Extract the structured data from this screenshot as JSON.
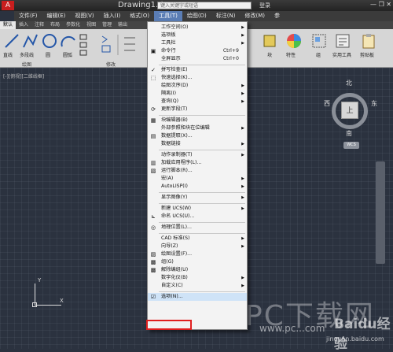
{
  "titlebar": {
    "app_button": "A",
    "doc_title": "Drawing1.d...",
    "search_placeholder": "键入关键字或短语",
    "signin": "登录",
    "window_controls": "— ❐ ✕"
  },
  "menubar": [
    {
      "label": "文件(F)"
    },
    {
      "label": "编辑(E)"
    },
    {
      "label": "视图(V)"
    },
    {
      "label": "插入(I)"
    },
    {
      "label": "格式(O)"
    },
    {
      "label": "工具(T)",
      "active": true
    },
    {
      "label": "绘图(D)"
    },
    {
      "label": "标注(N)"
    },
    {
      "label": "修改(M)"
    },
    {
      "label": "参"
    }
  ],
  "tabs": [
    {
      "label": "默认",
      "active": true
    },
    {
      "label": "插入"
    },
    {
      "label": "注释"
    },
    {
      "label": "布局"
    },
    {
      "label": "参数化"
    },
    {
      "label": "视图"
    },
    {
      "label": "管理"
    },
    {
      "label": "输出"
    }
  ],
  "ribbon": {
    "tools": [
      {
        "label": "直线",
        "icon": "line-icon"
      },
      {
        "label": "多段线",
        "icon": "polyline-icon"
      },
      {
        "label": "圆",
        "icon": "circle-icon"
      },
      {
        "label": "圆弧",
        "icon": "arc-icon"
      }
    ],
    "panel_draw": "绘图",
    "panel_modify": "修改",
    "right_tools": [
      {
        "label": "块",
        "icon": "block-icon"
      },
      {
        "label": "特性",
        "icon": "properties-icon"
      },
      {
        "label": "组",
        "icon": "group-icon"
      },
      {
        "label": "实用工具",
        "icon": "utilities-icon"
      },
      {
        "label": "剪贴板",
        "icon": "clipboard-icon"
      }
    ]
  },
  "viewport_label": "[-][俯视][二维线框]",
  "viewcube": {
    "north": "北",
    "south": "南",
    "east": "东",
    "west": "西",
    "face": "上",
    "wcs": "WCS"
  },
  "ucs": {
    "x": "X",
    "y": "Y"
  },
  "tools_menu": {
    "items": [
      {
        "label": "工作空间(O)",
        "arrow": true,
        "icon": ""
      },
      {
        "label": "选项板",
        "arrow": true,
        "icon": ""
      },
      {
        "label": "工具栏",
        "arrow": true,
        "icon": ""
      },
      {
        "label": "命令行",
        "shortcut": "Ctrl+9",
        "icon": "▣"
      },
      {
        "label": "全屏显示",
        "shortcut": "Ctrl+0",
        "icon": ""
      },
      {
        "sep": true
      },
      {
        "label": "拼写检查(E)",
        "icon": "✓"
      },
      {
        "label": "快速选择(K)...",
        "icon": "⬚"
      },
      {
        "label": "绘图次序(D)",
        "arrow": true,
        "icon": ""
      },
      {
        "label": "隔离(I)",
        "arrow": true,
        "icon": ""
      },
      {
        "label": "查询(Q)",
        "arrow": true,
        "icon": ""
      },
      {
        "label": "更新字段(T)",
        "icon": "⟳"
      },
      {
        "sep": true
      },
      {
        "label": "块编辑器(B)",
        "icon": "▦"
      },
      {
        "label": "外部参照和块在位编辑",
        "arrow": true,
        "icon": ""
      },
      {
        "label": "数据提取(X)...",
        "icon": "▤"
      },
      {
        "label": "数据链接",
        "arrow": true,
        "icon": ""
      },
      {
        "sep": true
      },
      {
        "label": "动作录制器(T)",
        "arrow": true,
        "icon": ""
      },
      {
        "label": "加载应用程序(L)...",
        "icon": "▥"
      },
      {
        "label": "运行脚本(R)...",
        "icon": "▧"
      },
      {
        "label": "宏(A)",
        "arrow": true,
        "icon": ""
      },
      {
        "label": "AutoLISP(I)",
        "arrow": true,
        "icon": ""
      },
      {
        "sep": true
      },
      {
        "label": "显示图像(Y)",
        "arrow": true,
        "icon": ""
      },
      {
        "sep": true
      },
      {
        "label": "新建 UCS(W)",
        "arrow": true,
        "icon": ""
      },
      {
        "label": "命名 UCS(U)...",
        "icon": "⊾"
      },
      {
        "sep": true
      },
      {
        "label": "地理位置(L)...",
        "icon": "◎"
      },
      {
        "sep": true
      },
      {
        "label": "CAD 标准(S)",
        "arrow": true,
        "icon": ""
      },
      {
        "label": "向导(Z)",
        "arrow": true,
        "icon": ""
      },
      {
        "label": "绘图设置(F)...",
        "icon": "▨"
      },
      {
        "label": "组(G)",
        "icon": "▩"
      },
      {
        "label": "解除编组(U)",
        "icon": "▩"
      },
      {
        "label": "数字化仪(B)",
        "arrow": true,
        "icon": ""
      },
      {
        "label": "自定义(C)",
        "arrow": true,
        "icon": ""
      },
      {
        "sep": true
      },
      {
        "label": "选项(N)...",
        "icon": "☑",
        "highlight": true
      }
    ]
  },
  "watermark": {
    "big": "PC下载网",
    "url": "www.pc...com",
    "baidu": "Baidu经验",
    "baidu_url": "jingyan.baidu.com"
  }
}
